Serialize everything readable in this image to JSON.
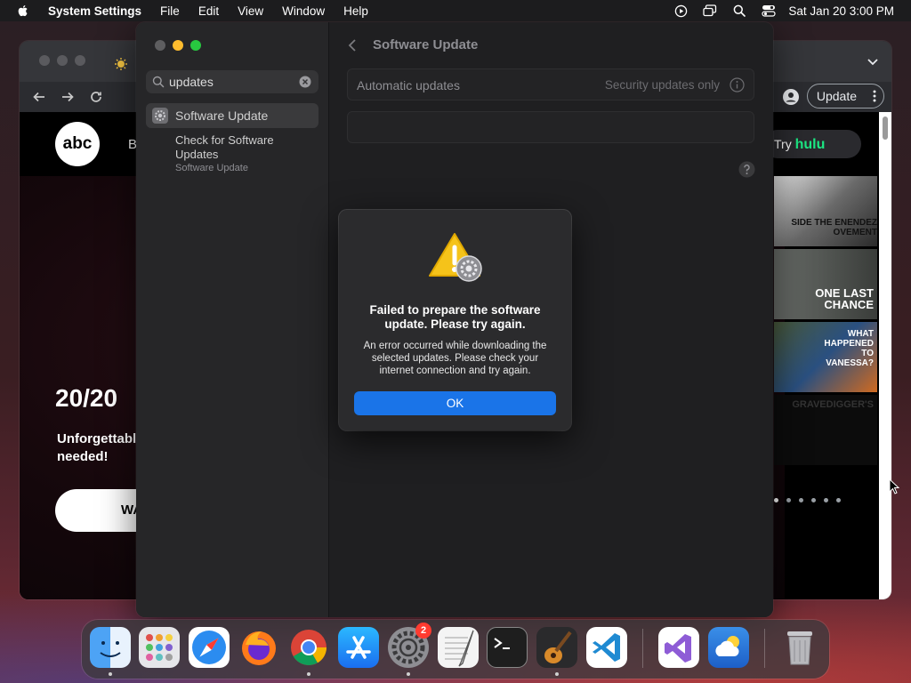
{
  "menubar": {
    "app_name": "System Settings",
    "menus": [
      "File",
      "Edit",
      "View",
      "Window",
      "Help"
    ],
    "clock": "Sat Jan 20  3:00 PM",
    "status_icons": [
      "screen-recording-icon",
      "screen-mirroring-icon",
      "spotlight-search-icon",
      "control-center-icon"
    ]
  },
  "browser": {
    "update_label": "Update",
    "hero_title": "20/20",
    "hero_sub": "Unforgettabl needed!",
    "hero_button": "WA",
    "nav_letter": "B",
    "try_label": "Try",
    "hulu_label": "hulu",
    "logo_text": "abc",
    "thumbnails": [
      {
        "title": "SIDE THE ENENDEZ OVEMENT"
      },
      {
        "title": "ONE LAST CHANCE"
      },
      {
        "title": "WHAT HAPPENED TO VANESSA?"
      },
      {
        "title": "GRAVEDIGGER'S"
      }
    ]
  },
  "settings": {
    "search_value": "updates",
    "sidebar_item": "Software Update",
    "sub_result": "Check for Software Updates",
    "sub_result_caption": "Software Update",
    "title": "Software Update",
    "auto_updates_label": "Automatic updates",
    "auto_updates_value": "Security updates only"
  },
  "alert": {
    "heading": "Failed to prepare the software update. Please try again.",
    "body": "An error occurred while downloading the selected updates. Please check your internet connection and try again.",
    "ok_label": "OK"
  },
  "dock": {
    "apps": [
      "Finder",
      "Launchpad",
      "Safari",
      "Firefox",
      "Chrome",
      "App Store",
      "System Settings",
      "TextEdit",
      "Terminal",
      "GarageBand",
      "Visual Studio Code",
      "Visual Studio",
      "Weather",
      "Trash"
    ],
    "settings_badge": "2"
  },
  "colors": {
    "accent": "#1a74e8",
    "badge": "#ff3b30",
    "hulu": "#1ce783"
  }
}
